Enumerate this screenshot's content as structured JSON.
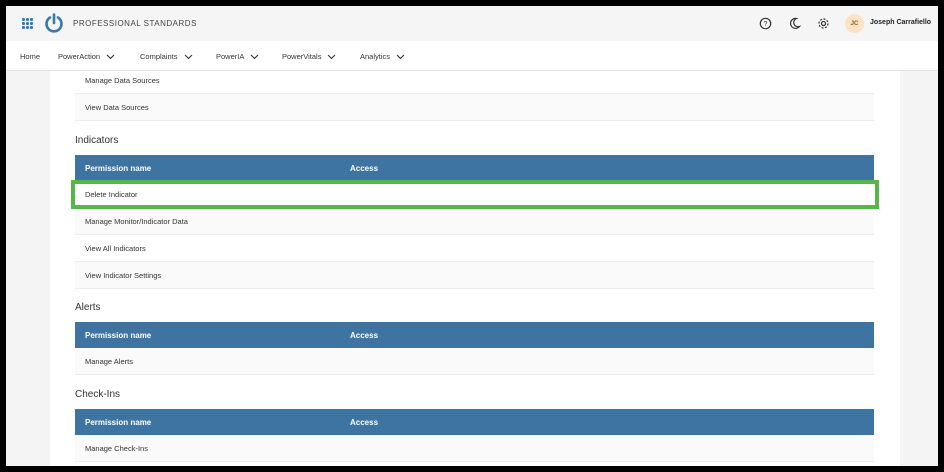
{
  "header": {
    "brand": "PROFESSIONAL STANDARDS",
    "user_initials": "JC",
    "user_name": "Joseph Carrafiello",
    "icons": [
      "apps-grid-icon",
      "power-logo-icon",
      "help-icon",
      "moon-icon",
      "gear-icon"
    ]
  },
  "nav": {
    "items": [
      {
        "label": "Home",
        "dropdown": false
      },
      {
        "label": "PowerAction",
        "dropdown": true
      },
      {
        "label": "Complaints",
        "dropdown": true
      },
      {
        "label": "PowerIA",
        "dropdown": true
      },
      {
        "label": "PowerVitals",
        "dropdown": true
      },
      {
        "label": "Analytics",
        "dropdown": true
      }
    ]
  },
  "data_sources": {
    "rows": [
      "Manage Data Sources",
      "View Data Sources"
    ]
  },
  "indicators": {
    "title": "Indicators",
    "col_name": "Permission name",
    "col_access": "Access",
    "rows": [
      "Delete Indicator",
      "Manage Monitor/Indicator Data",
      "View All Indicators",
      "View Indicator Settings"
    ]
  },
  "alerts": {
    "title": "Alerts",
    "col_name": "Permission name",
    "col_access": "Access",
    "rows": [
      "Manage Alerts"
    ]
  },
  "checkins": {
    "title": "Check-Ins",
    "col_name": "Permission name",
    "col_access": "Access",
    "rows": [
      "Manage Check-Ins"
    ]
  },
  "colors": {
    "table_header": "#3d74a2",
    "highlight": "#52b848",
    "brand_blue": "#3a78b0"
  }
}
